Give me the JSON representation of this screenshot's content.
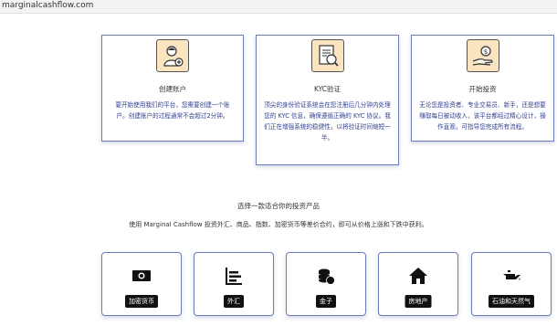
{
  "browser": {
    "url": "marginalcashflow.com"
  },
  "cards": [
    {
      "title": "创建账户",
      "icon": "user-add-icon",
      "desc": "要开始使用我们的平台，您需要创建一个账户。创建账户的过程通常不会超过2分钟。"
    },
    {
      "title": "KYC验证",
      "icon": "document-search-icon",
      "desc": "顶尖的身份验证系统会在您注册后几分钟内处理您的 KYC 信息，确保遵循正确的 KYC 协议。我们正在增强系统的稳健性，以将验证时间缩短一半。"
    },
    {
      "title": "开始投资",
      "icon": "hand-money-icon",
      "desc": "无论您是投资者、专业交易员、新手，还是想要赚取每日被动收入，该平台都经过精心设计，操作直观，可指导您完成所有流程。"
    }
  ],
  "products_section": {
    "title": "选择一款适合你的投资产品",
    "desc": "使用 Marginal Cashflow 投资外汇、商品、指数、加密货币等差价合约，即可从价格上涨和下跌中获利。"
  },
  "products": [
    {
      "label": "加密货币",
      "icon": "money-bill-icon"
    },
    {
      "label": "外汇",
      "icon": "bar-chart-icon"
    },
    {
      "label": "金子",
      "icon": "coins-stack-icon"
    },
    {
      "label": "房地产",
      "icon": "house-icon"
    },
    {
      "label": "石油和天然气",
      "icon": "oil-can-icon"
    }
  ]
}
